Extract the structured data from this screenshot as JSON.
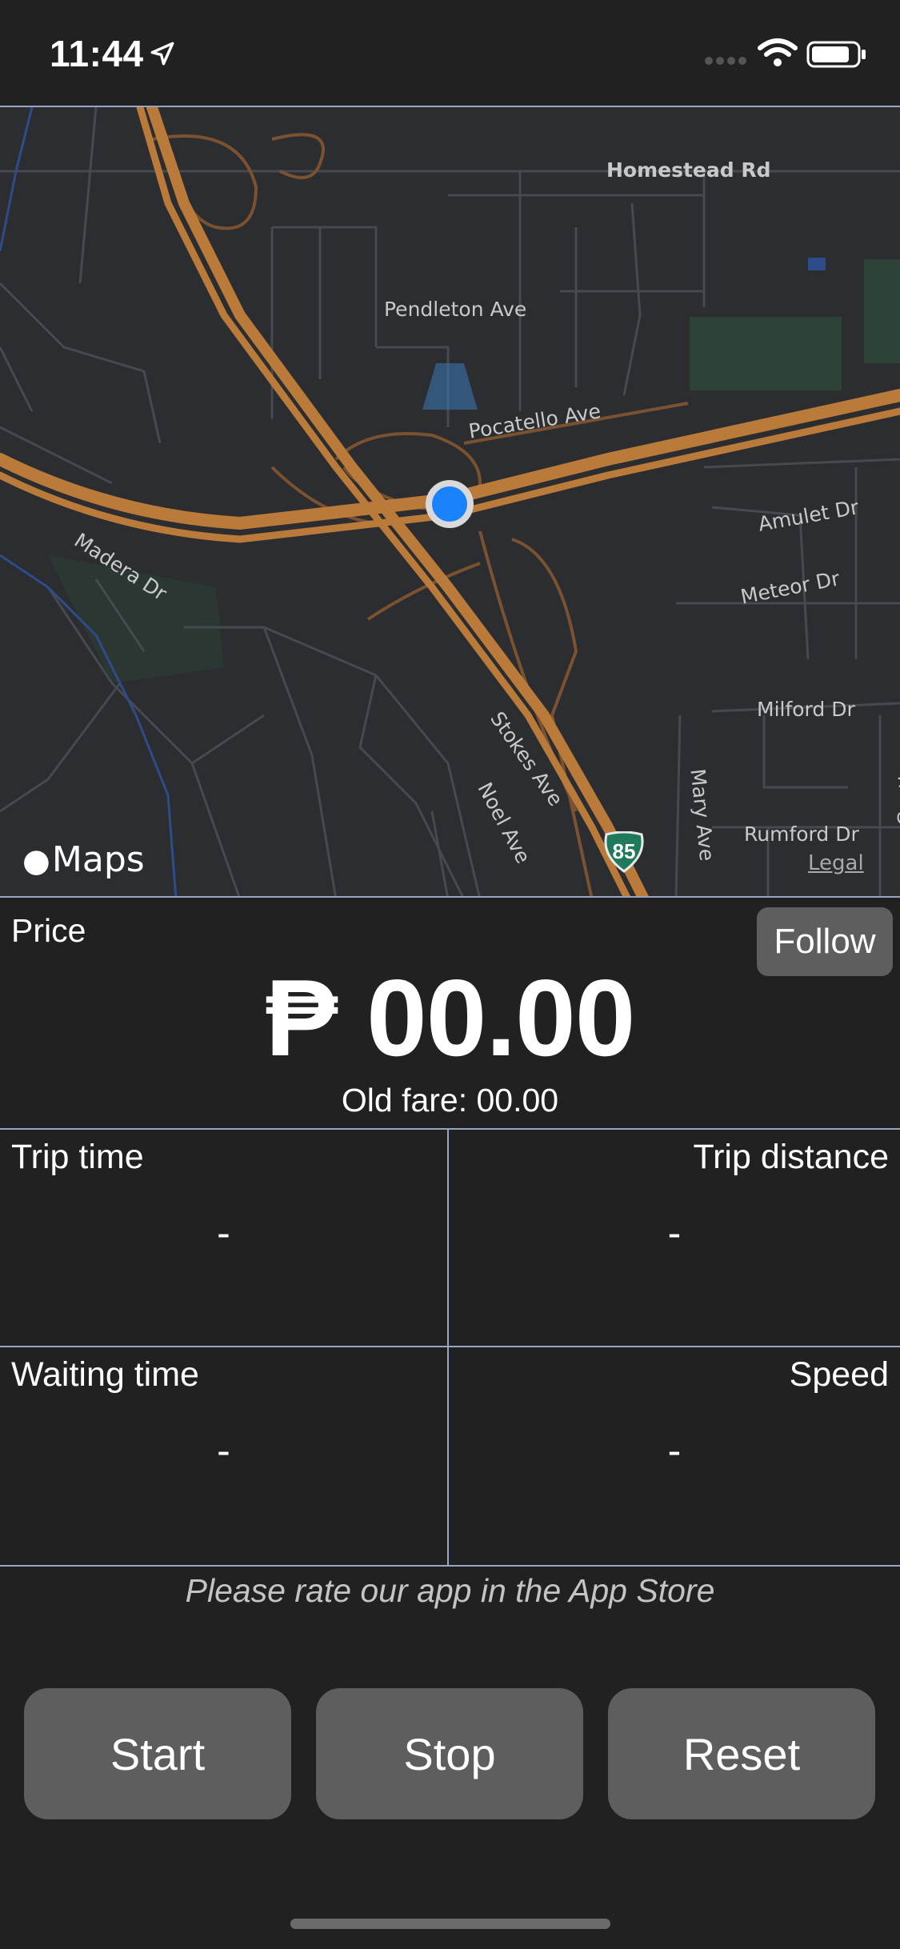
{
  "status_bar": {
    "time": "11:44",
    "icons": [
      "location-arrow-icon",
      "signal-icon",
      "wifi-icon",
      "battery-icon"
    ]
  },
  "map": {
    "labels": {
      "homestead": "Homestead Rd",
      "pendleton": "Pendleton Ave",
      "pocatello": "Pocatello Ave",
      "amulet": "Amulet Dr",
      "meteor": "Meteor Dr",
      "milford": "Milford Dr",
      "madera": "Madera Dr",
      "stokes": "Stokes Ave",
      "noel": "Noel Ave",
      "mary": "Mary Ave",
      "rumford": "Rumford Dr",
      "castine": "Castine Ave"
    },
    "highway_shield": "85",
    "logo_text": "Maps",
    "legal": "Legal"
  },
  "price": {
    "label": "Price",
    "value": "₱ 00.00",
    "old_fare": "Old fare: 00.00",
    "follow_button": "Follow"
  },
  "stats": {
    "trip_time": {
      "label": "Trip time",
      "value": "-"
    },
    "trip_distance": {
      "label": "Trip distance",
      "value": "-"
    },
    "waiting_time": {
      "label": "Waiting time",
      "value": "-"
    },
    "speed": {
      "label": "Speed",
      "value": "-"
    }
  },
  "rate_prompt": "Please rate our app in the App Store",
  "buttons": {
    "start": "Start",
    "stop": "Stop",
    "reset": "Reset"
  },
  "colors": {
    "background": "#212121",
    "button": "#5e5e5e",
    "divider": "#9aa4c4",
    "highway": "#b97a3a",
    "location_dot": "#1a82fb"
  }
}
